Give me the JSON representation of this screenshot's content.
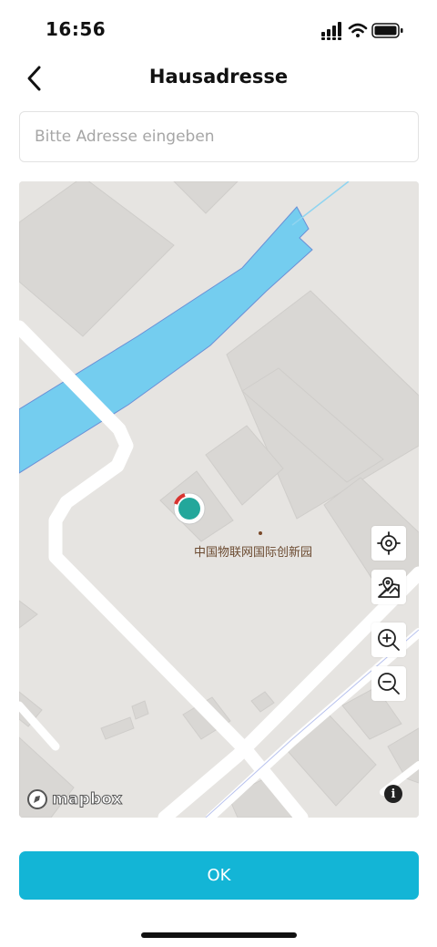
{
  "status_bar": {
    "time": "16:56",
    "icons": [
      "cellular-icon",
      "wifi-icon",
      "battery-icon"
    ]
  },
  "header": {
    "title": "Hausadresse",
    "back_icon": "chevron-left-icon"
  },
  "search": {
    "placeholder": "Bitte Adresse eingeben",
    "value": ""
  },
  "map": {
    "poi_label": "中国物联网国际创新园",
    "attribution": "mapbox",
    "controls": [
      "locate-icon",
      "map-pin-icon",
      "zoom-in-icon",
      "zoom-out-icon"
    ],
    "colors": {
      "land": "#e6e4e1",
      "building": "#d8d6d3",
      "water": "#74cdef",
      "road": "#ffffff",
      "pin": "#23a79b"
    }
  },
  "footer": {
    "ok_label": "OK"
  },
  "colors": {
    "accent": "#13b5d6"
  }
}
